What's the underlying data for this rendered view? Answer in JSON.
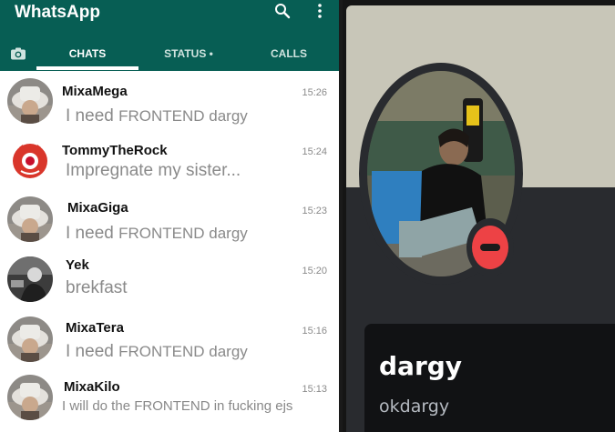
{
  "app": {
    "title": "WhatsApp"
  },
  "header_icons": [
    "search-icon",
    "more-vert-icon"
  ],
  "tabs": [
    {
      "id": "camera",
      "icon": "camera-icon",
      "label": ""
    },
    {
      "id": "chats",
      "label": "CHATS",
      "active": true
    },
    {
      "id": "status",
      "label": "STATUS •"
    },
    {
      "id": "calls",
      "label": "CALLS"
    }
  ],
  "chats": [
    {
      "name": "MixaMega",
      "time": "15:26",
      "message_small": "I need",
      "message_big": "FRONTEND dargy",
      "avatar": "hat-avatar"
    },
    {
      "name": "TommyTheRock",
      "time": "15:24",
      "message_small": "Impregnate my",
      "message_big": "sister...",
      "avatar": "red-mascot-avatar"
    },
    {
      "name": "MixaGiga",
      "time": "15:23",
      "message_small": "I need",
      "message_big": "FRONTEND dargy",
      "avatar": "hat-avatar"
    },
    {
      "name": "Yek",
      "time": "15:20",
      "message_small": "brekfast",
      "message_big": "",
      "avatar": "grayscale-person-avatar"
    },
    {
      "name": "MixaTera",
      "time": "15:16",
      "message_small": "I need",
      "message_big": "FRONTEND dargy",
      "avatar": "hat-avatar"
    },
    {
      "name": "MixaKilo",
      "time": "15:13",
      "message_small": "I will do the FRONTEND in fucking ejs",
      "message_big": "",
      "avatar": "hat-avatar"
    }
  ],
  "profile": {
    "display_name": "dargy",
    "username": "okdargy",
    "status": "do-not-disturb",
    "banner_color": "#c8c6b8",
    "card_color": "#292b2f",
    "status_color": "#ed4245"
  },
  "colors": {
    "header": "#075e54",
    "accent": "#ffffff",
    "time": "#8a8a8a"
  }
}
